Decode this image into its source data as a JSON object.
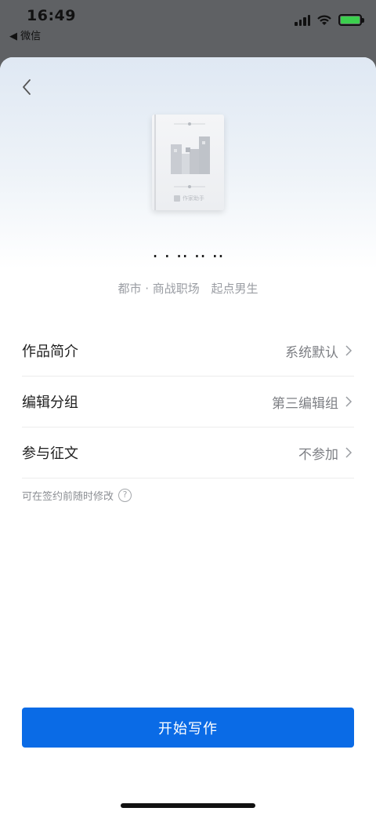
{
  "status_bar": {
    "time": "16:49",
    "back_app": "◀ 微信"
  },
  "book": {
    "title": "· ·  ·· ·· ·· ",
    "category": "都市 · 商战职场",
    "channel": "起点男生",
    "cover_logo_text": "作家助手"
  },
  "rows": [
    {
      "label": "作品简介",
      "value": "系统默认"
    },
    {
      "label": "编辑分组",
      "value": "第三编辑组"
    },
    {
      "label": "参与征文",
      "value": "不参加"
    }
  ],
  "hint": "可在签约前随时修改",
  "start_button": "开始写作",
  "colors": {
    "primary": "#0a6be6",
    "battery": "#3ccf4e"
  }
}
